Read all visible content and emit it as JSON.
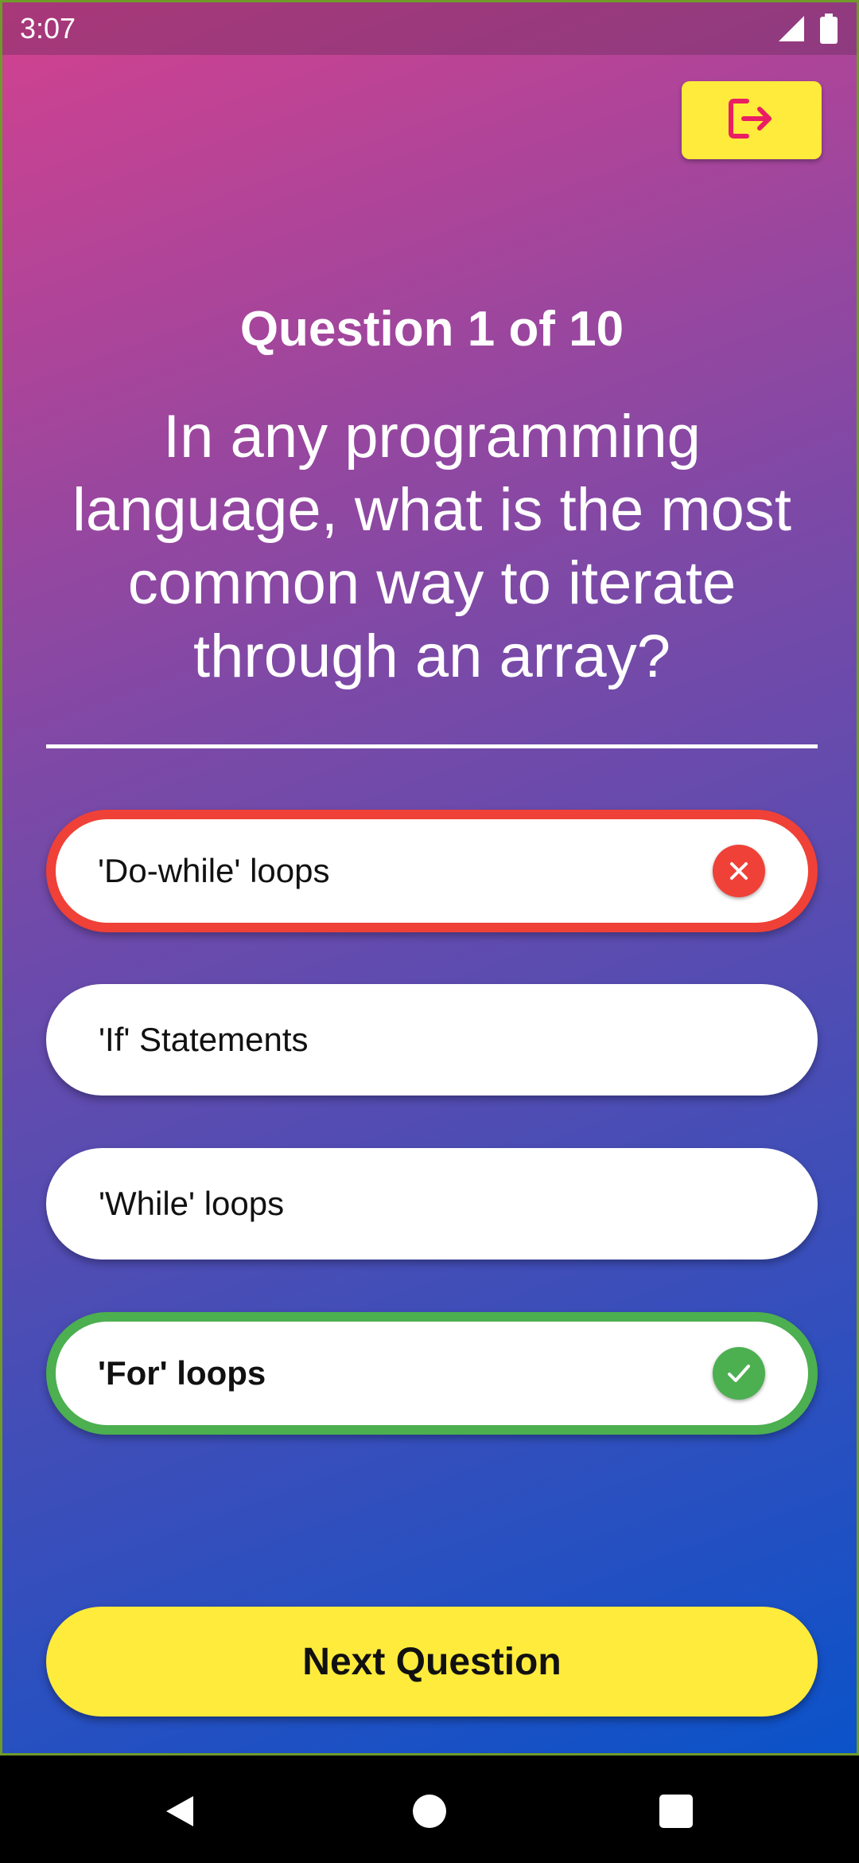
{
  "status_bar": {
    "time": "3:07",
    "icons": [
      "signal-icon",
      "battery-icon"
    ]
  },
  "header": {
    "exit_icon": "exit-icon",
    "exit_color": "#e91e63"
  },
  "quiz": {
    "progress": "Question 1 of 10",
    "question": "In any programming language, what is the most common way to iterate through an array?",
    "answers": [
      {
        "label": "'Do-while' loops",
        "state": "wrong"
      },
      {
        "label": "'If' Statements",
        "state": "neutral"
      },
      {
        "label": "'While' loops",
        "state": "neutral"
      },
      {
        "label": "'For' loops",
        "state": "correct"
      }
    ]
  },
  "footer": {
    "next_label": "Next Question"
  },
  "colors": {
    "accent_yellow": "#ffeb3b",
    "wrong_red": "#ef4137",
    "correct_green": "#4caf50"
  },
  "nav": {
    "icons": [
      "back-icon",
      "home-icon",
      "recents-icon"
    ]
  }
}
